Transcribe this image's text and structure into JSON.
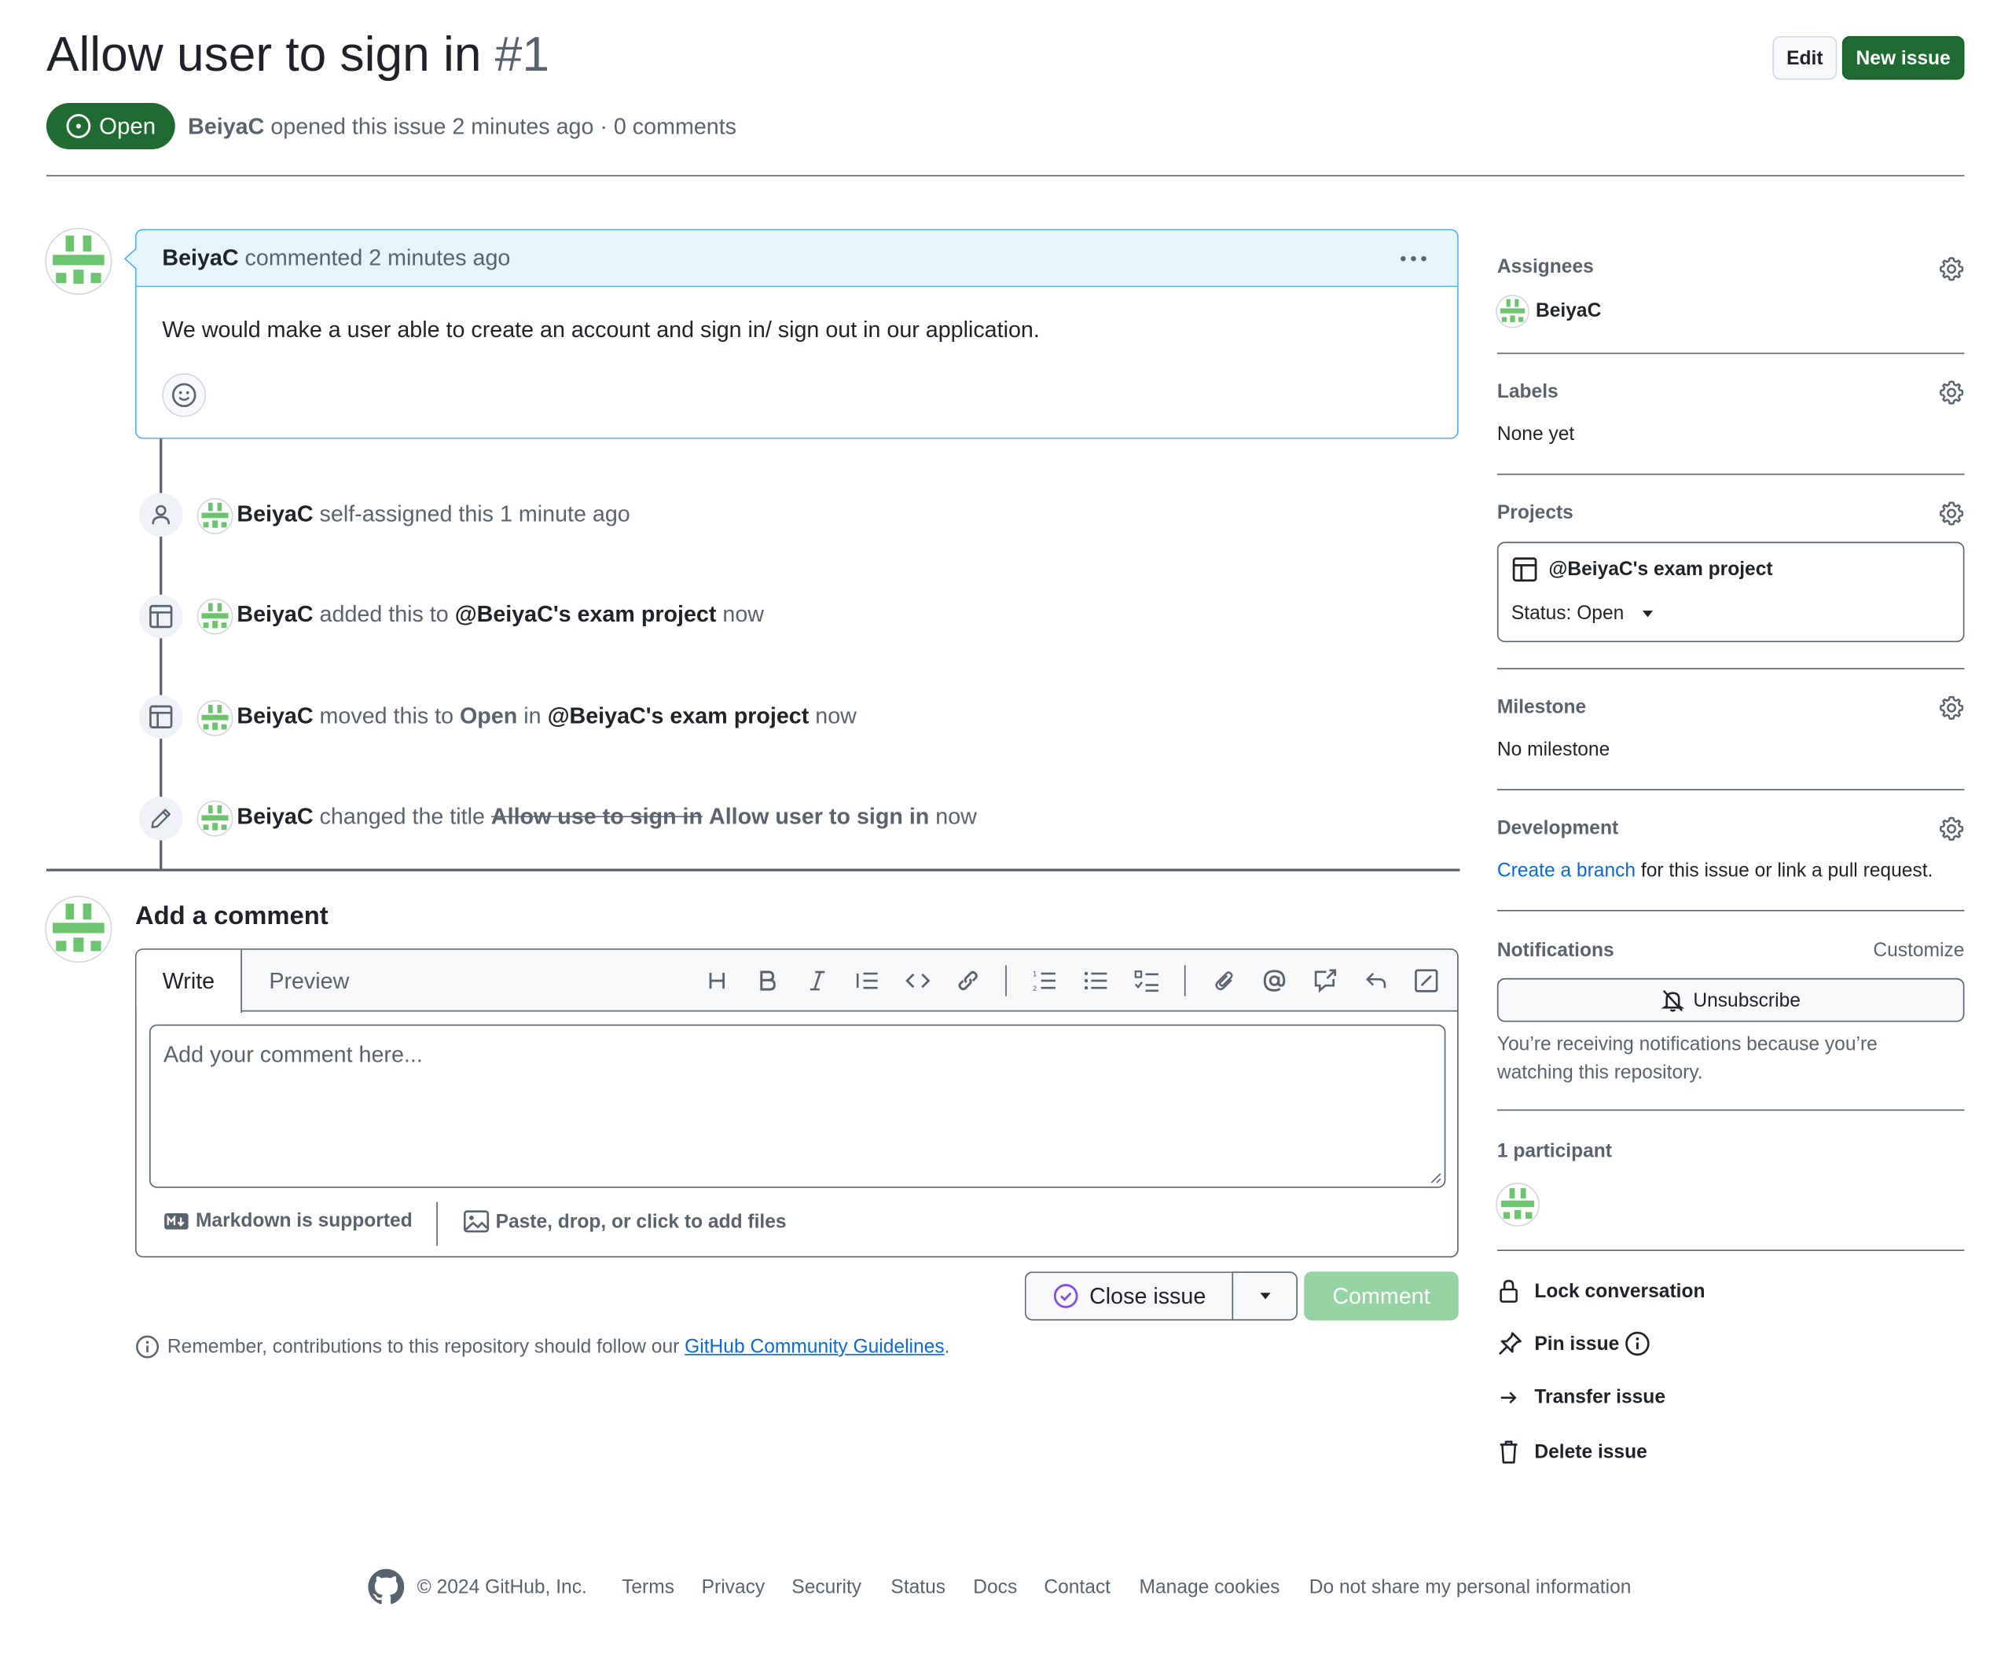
{
  "issue": {
    "title": "Allow user to sign in",
    "number": "#1",
    "state": "Open",
    "author": "BeiyaC",
    "meta": "opened this issue 2 minutes ago · 0 comments",
    "edit_label": "Edit",
    "new_issue_label": "New issue"
  },
  "comment": {
    "author": "BeiyaC",
    "time": "commented 2 minutes ago",
    "body": "We would make a user able to create an account and sign in/ sign out in our application."
  },
  "timeline": [
    {
      "actor": "BeiyaC",
      "text": "self-assigned this 1 minute ago"
    },
    {
      "actor": "BeiyaC",
      "pre": "added this to",
      "project": "@BeiyaC's exam project",
      "post": "now"
    },
    {
      "actor": "BeiyaC",
      "pre": "moved this to",
      "column": "Open",
      "mid": "in",
      "project": "@BeiyaC's exam project",
      "post": "now"
    },
    {
      "actor": "BeiyaC",
      "pre": "changed the title",
      "old_title": "Allow use to sign in",
      "new_title": "Allow user to sign in",
      "post": "now"
    }
  ],
  "composer": {
    "heading": "Add a comment",
    "tab_write": "Write",
    "tab_preview": "Preview",
    "placeholder": "Add your comment here...",
    "markdown_note": "Markdown is supported",
    "files_note": "Paste, drop, or click to add files",
    "close_issue_label": "Close issue",
    "comment_label": "Comment",
    "guidelines_pre": "Remember, contributions to this repository should follow our",
    "guidelines_link": "GitHub Community Guidelines",
    "guidelines_post": "."
  },
  "sidebar": {
    "assignees_heading": "Assignees",
    "assignee": "BeiyaC",
    "labels_heading": "Labels",
    "labels_value": "None yet",
    "projects_heading": "Projects",
    "project_name": "@BeiyaC's exam project",
    "project_status": "Status: Open",
    "milestone_heading": "Milestone",
    "milestone_value": "No milestone",
    "development_heading": "Development",
    "dev_link": "Create a branch",
    "dev_rest": "for this issue or link a pull request.",
    "notifications_heading": "Notifications",
    "customize_label": "Customize",
    "unsubscribe_label": "Unsubscribe",
    "notif_reason_1": "You’re receiving notifications because you’re",
    "notif_reason_2": "watching this repository.",
    "participants_heading": "1 participant",
    "lock_label": "Lock conversation",
    "pin_label": "Pin issue",
    "transfer_label": "Transfer issue",
    "delete_label": "Delete issue"
  },
  "footer": {
    "copyright": "© 2024 GitHub, Inc.",
    "links": [
      "Terms",
      "Privacy",
      "Security",
      "Status",
      "Docs",
      "Contact",
      "Manage cookies",
      "Do not share my personal information"
    ]
  },
  "colors": {
    "open_green": "#1f6b31",
    "comment_header_bg": "#e6f4fc",
    "accent_blue": "#0969da",
    "comment_disabled": "#94d3a2"
  }
}
